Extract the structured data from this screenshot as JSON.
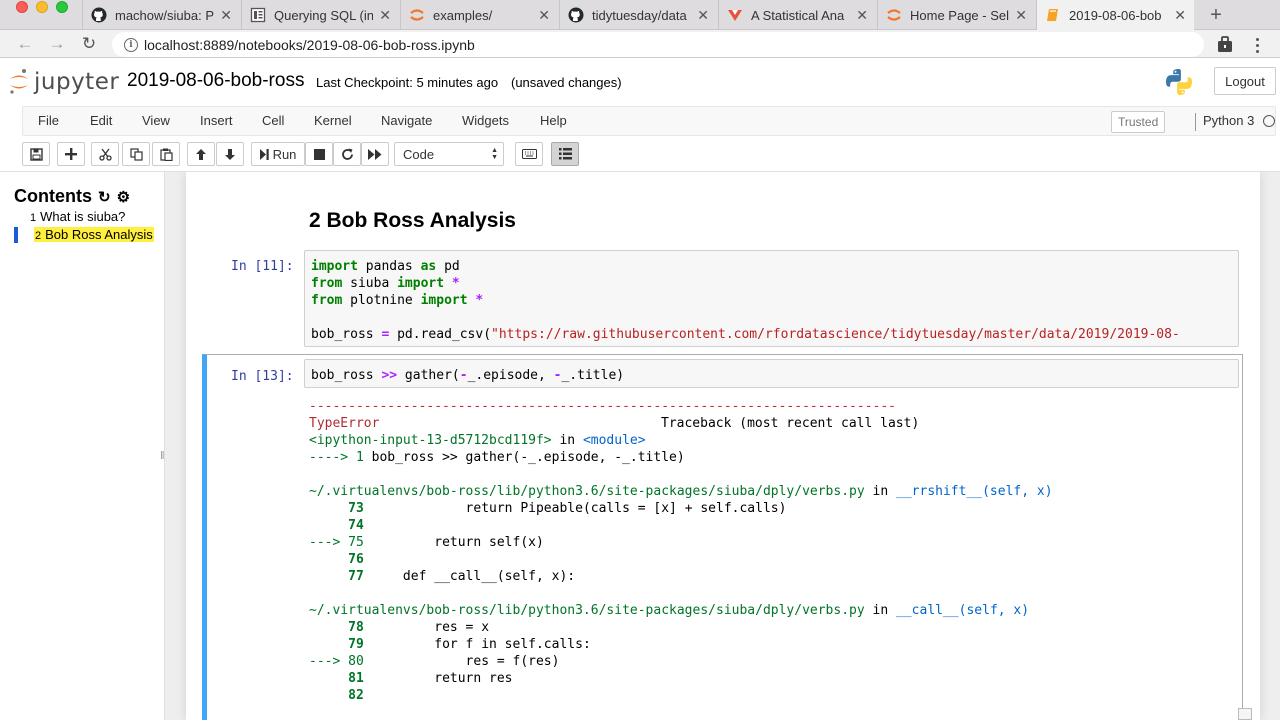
{
  "browser": {
    "tabs": [
      {
        "title": "machow/siuba: P",
        "icon": "github-icon"
      },
      {
        "title": "Querying SQL (in",
        "icon": "document-icon"
      },
      {
        "title": "examples/",
        "icon": "jupyter-icon"
      },
      {
        "title": "tidytuesday/data",
        "icon": "github-icon"
      },
      {
        "title": "A Statistical Ana",
        "icon": "blog-icon"
      },
      {
        "title": "Home Page - Sel",
        "icon": "jupyter-icon"
      },
      {
        "title": "2019-08-06-bob",
        "icon": "notebook-icon"
      }
    ],
    "url": "localhost:8889/notebooks/2019-08-06-bob-ross.ipynb"
  },
  "header": {
    "logo_text": "jupyter",
    "notebook_title": "2019-08-06-bob-ross",
    "checkpoint": "Last Checkpoint: 5 minutes ago",
    "unsaved": "(unsaved changes)",
    "logout": "Logout"
  },
  "menubar": {
    "items": [
      "File",
      "Edit",
      "View",
      "Insert",
      "Cell",
      "Kernel",
      "Navigate",
      "Widgets",
      "Help"
    ],
    "trusted": "Trusted",
    "kernel": "Python 3"
  },
  "toolbar": {
    "run_label": "Run",
    "cell_type": "Code"
  },
  "toc": {
    "title": "Contents",
    "items": [
      {
        "num": "1",
        "label": "What is siuba?"
      },
      {
        "num": "2",
        "label": "Bob Ross Analysis"
      }
    ]
  },
  "notebook": {
    "heading": "2  Bob Ross Analysis",
    "cell1": {
      "prompt": "In [11]:",
      "lines": [
        "import pandas as pd",
        "from siuba import *",
        "from plotnine import *",
        "",
        "bob_ross = pd.read_csv(\"https://raw.githubusercontent.com/rfordatascience/tidytuesday/master/data/2019/2019-08-"
      ]
    },
    "cell2": {
      "prompt": "In [13]:",
      "code": "bob_ross >> gather(-_.episode, -_.title)"
    },
    "traceback": {
      "dashes": "---------------------------------------------------------------------------",
      "error_name": "TypeError",
      "traceback_title": "Traceback (most recent call last)",
      "input_ref": "<ipython-input-13-d5712bcd119f>",
      "in_word": " in ",
      "module": "<module>",
      "arrow1": "----> 1 ",
      "arrow1_code": "bob_ross >> gather(-_.episode, -_.title)",
      "file1": "~/.virtualenvs/bob-ross/lib/python3.6/site-packages/siuba/dply/verbs.py",
      "func1": "__rrshift__",
      "sig1": "(self, x)",
      "frame1": [
        {
          "marker": "     73 ",
          "code": "            return Pipeable(calls = [x] + self.calls)"
        },
        {
          "marker": "     74 ",
          "code": ""
        },
        {
          "marker": "---> 75 ",
          "code": "        return self(x)"
        },
        {
          "marker": "     76 ",
          "code": ""
        },
        {
          "marker": "     77 ",
          "code": "    def __call__(self, x):"
        }
      ],
      "file2": "~/.virtualenvs/bob-ross/lib/python3.6/site-packages/siuba/dply/verbs.py",
      "func2": "__call__",
      "sig2": "(self, x)",
      "frame2": [
        {
          "marker": "     78 ",
          "code": "        res = x"
        },
        {
          "marker": "     79 ",
          "code": "        for f in self.calls:"
        },
        {
          "marker": "---> 80 ",
          "code": "            res = f(res)"
        },
        {
          "marker": "     81 ",
          "code": "        return res"
        },
        {
          "marker": "     82 ",
          "code": ""
        }
      ]
    }
  },
  "colors": {
    "selected_cell_border": "#42a5f5",
    "toc_highlight": "#ffef3e",
    "prompt_in": "#303f9f"
  }
}
